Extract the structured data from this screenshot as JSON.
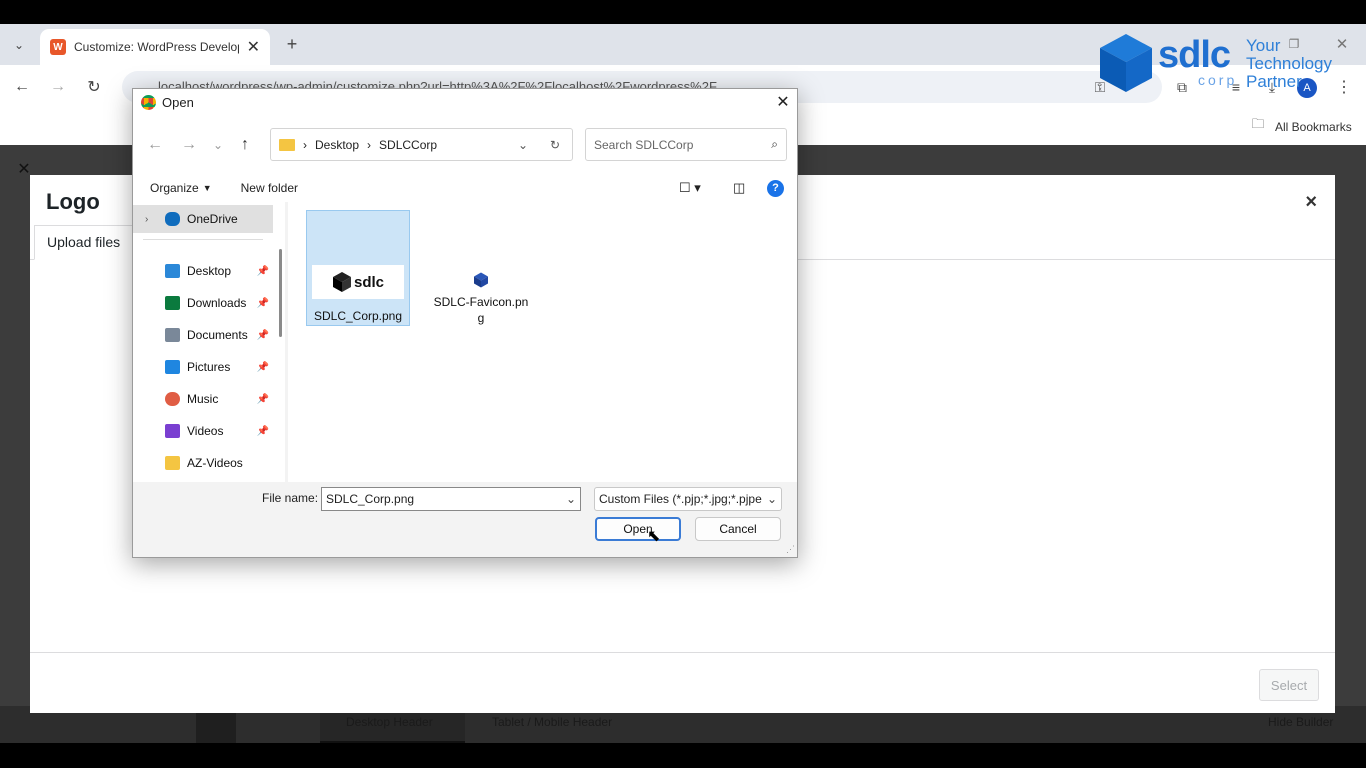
{
  "browser": {
    "tab_title": "Customize: WordPress Develop",
    "url": "localhost/wordpress/wp-admin/customize.php?url=http%3A%2F%2Flocalhost%2Fwordpress%2F",
    "bookmarks_label": "All Bookmarks",
    "profile_initial": "A"
  },
  "brand": {
    "logo_text": "sdlc",
    "corp_text": "corp",
    "tagline_1": "Your",
    "tagline_2": "Technology",
    "tagline_3": "Partner"
  },
  "media_modal": {
    "title": "Logo",
    "upload_tab": "Upload files",
    "select_button": "Select",
    "close_glyph": "×"
  },
  "customizer_bottom": {
    "desktop_header": "Desktop Header",
    "tablet_header": "Tablet / Mobile Header",
    "hide_builder": "Hide Builder"
  },
  "dialog": {
    "title": "Open",
    "breadcrumb": [
      "Desktop",
      "SDLCCorp"
    ],
    "search_placeholder": "Search SDLCCorp",
    "organize": "Organize",
    "new_folder": "New folder",
    "nav_items": [
      {
        "label": "OneDrive",
        "color": "#0f6cbd",
        "pinned": false
      },
      {
        "label": "Desktop",
        "color": "#2b88d8",
        "pinned": true
      },
      {
        "label": "Downloads",
        "color": "#0b7a3e",
        "pinned": true
      },
      {
        "label": "Documents",
        "color": "#7a8899",
        "pinned": true
      },
      {
        "label": "Pictures",
        "color": "#1f86e0",
        "pinned": true
      },
      {
        "label": "Music",
        "color": "#e05d44",
        "pinned": true
      },
      {
        "label": "Videos",
        "color": "#7a3fd1",
        "pinned": true
      },
      {
        "label": "AZ-Videos",
        "color": "#f4c542",
        "pinned": false
      }
    ],
    "files": [
      {
        "name": "SDLC_Corp.png",
        "selected": true
      },
      {
        "name": "SDLC-Favicon.pn\ng",
        "selected": false
      }
    ],
    "file_name_label": "File name:",
    "file_name_value": "SDLC_Corp.png",
    "file_type": "Custom Files (*.pjp;*.jpg;*.pjpe",
    "open_button": "Open",
    "cancel_button": "Cancel"
  }
}
